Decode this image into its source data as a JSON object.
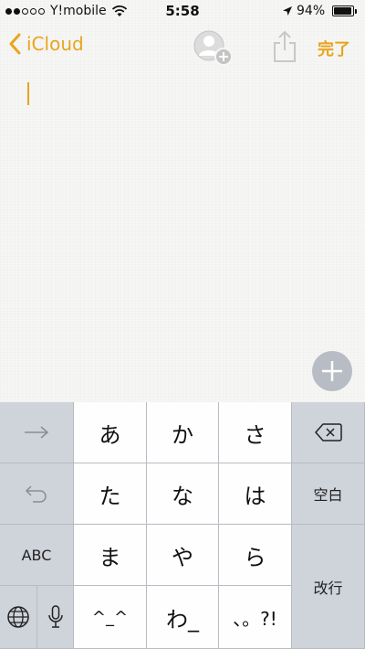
{
  "status_bar": {
    "carrier": "Y!mobile",
    "time": "5:58",
    "battery": "94%",
    "battery_level": 0.94,
    "signal_bars_filled": 2,
    "signal_bars_total": 5
  },
  "nav": {
    "back_label": "iCloud",
    "done_label": "完了"
  },
  "colors": {
    "accent": "#e9a51d",
    "keyboard_bg": "#cfd3da",
    "key_white": "#fefefe",
    "fab": "#b8bcc4"
  },
  "keyboard": {
    "row1": [
      "あ",
      "か",
      "さ"
    ],
    "row2": [
      "た",
      "な",
      "は"
    ],
    "row3": [
      "ま",
      "や",
      "ら"
    ],
    "row4": [
      "^_^",
      "わ_",
      "、。?!"
    ],
    "abc_label": "ABC",
    "space_label": "空白",
    "return_label": "改行"
  },
  "icons": {
    "wifi": "wifi-icon",
    "location": "location-arrow-icon",
    "back": "chevron-left-icon",
    "add_person": "add-person-icon",
    "share": "share-icon",
    "add": "plus-icon",
    "next": "arrow-right-icon",
    "undo": "undo-icon",
    "delete": "delete-backspace-icon",
    "globe": "globe-icon",
    "mic": "microphone-icon"
  }
}
